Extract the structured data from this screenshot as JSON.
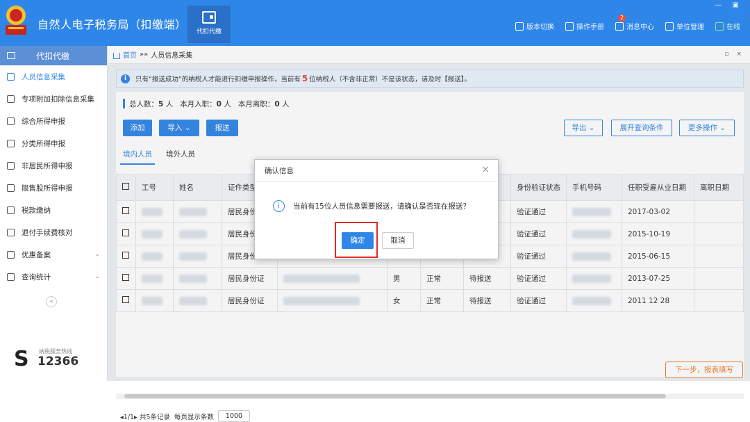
{
  "app": {
    "title": "自然人电子税务局（扣缴端）",
    "module_label": "代扣代缴",
    "window_controls": "—  ▣",
    "links": [
      {
        "label": "版本切换",
        "icon": "switch-icon"
      },
      {
        "label": "操作手册",
        "icon": "manual-icon"
      },
      {
        "label": "消息中心",
        "icon": "mail-icon",
        "badge": "2"
      },
      {
        "label": "单位管理",
        "icon": "building-icon"
      },
      {
        "label": "在线",
        "icon": "online-icon"
      }
    ]
  },
  "sidebar": {
    "header": "代扣代缴",
    "items": [
      {
        "label": "人员信息采集",
        "icon": "people-icon",
        "active": true
      },
      {
        "label": "专项附加扣除信息采集",
        "icon": "list-icon"
      },
      {
        "label": "综合所得申报",
        "icon": "layers-icon"
      },
      {
        "label": "分类所得申报",
        "icon": "clock-icon"
      },
      {
        "label": "非居民所得申报",
        "icon": "person-icon"
      },
      {
        "label": "限售股所得申报",
        "icon": "chart-icon"
      },
      {
        "label": "税款缴纳",
        "icon": "wallet-icon"
      },
      {
        "label": "退付手续费核对",
        "icon": "doc-icon"
      },
      {
        "label": "优惠备案",
        "icon": "bookmark-icon",
        "chevron": true
      },
      {
        "label": "查询统计",
        "icon": "stats-icon",
        "chevron": true
      }
    ],
    "collapse": "«",
    "hotline_label": "纳税服务热线",
    "hotline_number": "12366"
  },
  "breadcrumb": {
    "home": "首页",
    "sep": "»»",
    "current": "人员信息采集",
    "controls": "▫ ×"
  },
  "notice": {
    "icon": "i",
    "before": "只有“报送成功”的纳税人才能进行扣缴申报操作，当前有",
    "count": "5",
    "after": "位纳税人（不含非正常）不是该状态，请及时【报送】。"
  },
  "stats": {
    "total_label": "总人数：",
    "total": "5",
    "total_unit": "人",
    "hire_label": "本月入职：",
    "hire": "0",
    "hire_unit": "人",
    "leave_label": "本月离职：",
    "leave": "0",
    "leave_unit": "人"
  },
  "toolbar": {
    "add": "添加",
    "import": "导入 ⌄",
    "submit": "报送",
    "export": "导出 ⌄",
    "expand_query": "展开查询条件",
    "more": "更多操作 ⌄"
  },
  "tabs": [
    "境内人员",
    "境外人员"
  ],
  "table": {
    "columns": [
      "工号",
      "姓名",
      "证件类型",
      "",
      "",
      "",
      "",
      "身份验证状态",
      "手机号码",
      "任职受雇从业日期",
      "离职日期"
    ],
    "rows": [
      {
        "id_type": "居民身份证",
        "gender": "",
        "status": "",
        "report": "",
        "verify": "验证通过",
        "date": "2017-03-02"
      },
      {
        "id_type": "居民身份证",
        "gender": "",
        "status": "",
        "report": "",
        "verify": "验证通过",
        "date": "2015-10-19"
      },
      {
        "id_type": "居民身份证",
        "gender": "",
        "status": "",
        "report": "",
        "verify": "验证通过",
        "date": "2015-06-15"
      },
      {
        "id_type": "居民身份证",
        "gender": "男",
        "status": "正常",
        "report": "待报送",
        "verify": "验证通过",
        "date": "2013-07-25"
      },
      {
        "id_type": "居民身份证",
        "gender": "女",
        "status": "正常",
        "report": "待报送",
        "verify": "验证通过",
        "date": "2011 12 28"
      }
    ]
  },
  "pager": {
    "info": "◂1/1▸ 共5条记录",
    "per_page_label": "每页显示条数",
    "per_page": "1000"
  },
  "next_step": "下一步，报表填写",
  "dialog": {
    "title": "确认信息",
    "close": "×",
    "icon": "i",
    "message": "当前有15位人员信息需要报送，请确认是否现在报送？",
    "ok": "确定",
    "cancel": "取消"
  },
  "colors": {
    "primary": "#2f86e9",
    "warning": "#f07a2c",
    "highlight": "#e32727"
  }
}
